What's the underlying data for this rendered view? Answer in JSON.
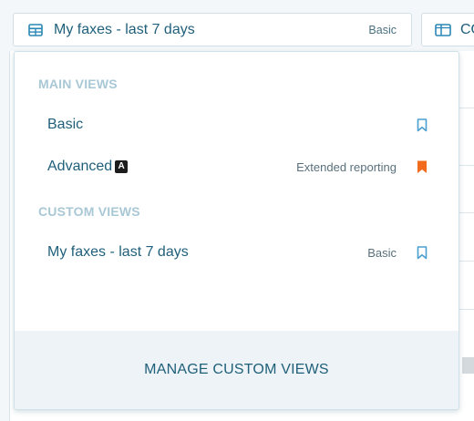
{
  "view_selector": {
    "label": "My faxes - last 7 days",
    "badge": "Basic",
    "icon": "table-icon"
  },
  "columns_button": {
    "label": "CO",
    "icon": "columns-icon"
  },
  "dropdown": {
    "main_views_title": "MAIN VIEWS",
    "main_views": [
      {
        "label": "Basic",
        "note": "",
        "bookmark": "bookmark-outline-icon",
        "bookmarked": false
      },
      {
        "label": "Advanced",
        "badge_letter": "A",
        "note": "Extended reporting",
        "bookmark": "bookmark-filled-icon",
        "bookmarked": true
      }
    ],
    "custom_views_title": "CUSTOM VIEWS",
    "custom_views": [
      {
        "label": "My faxes - last 7 days",
        "note": "Basic",
        "bookmark": "bookmark-outline-icon",
        "bookmarked": false
      }
    ],
    "footer_link": "MANAGE CUSTOM VIEWS"
  },
  "colors": {
    "accent": "#1f5f7a",
    "section_title": "#a9c8d6",
    "bookmark_outline": "#4a9fd0",
    "bookmark_filled": "#f26a1b",
    "footer_bg": "#edf3f6"
  }
}
